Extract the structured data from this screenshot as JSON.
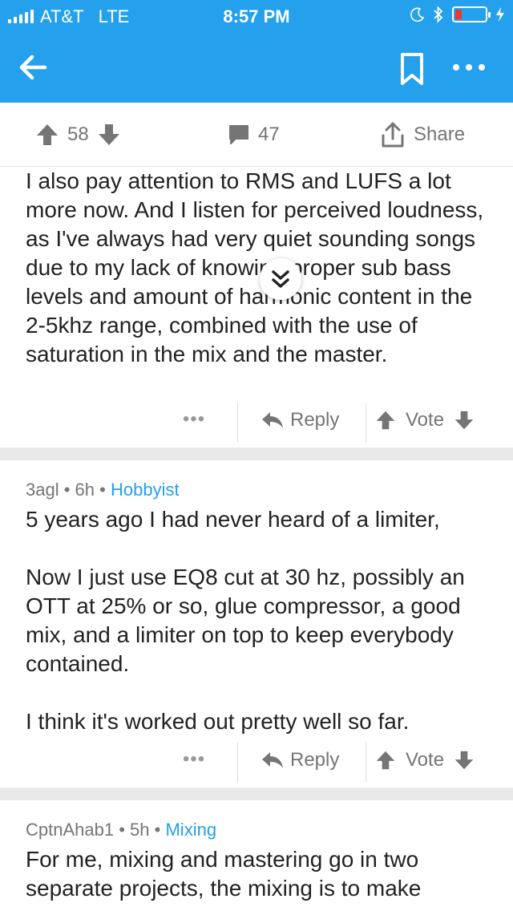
{
  "status_bar": {
    "carrier": "AT&T",
    "network": "LTE",
    "time": "8:57 PM",
    "battery_percent": 12
  },
  "post_actions": {
    "upvotes": "58",
    "comments": "47",
    "share_label": "Share"
  },
  "comments": [
    {
      "text": "I also pay attention to RMS and LUFS a lot more now.  And I listen for perceived loudness, as I've always had very quiet sounding songs due to my lack of knowing proper sub bass levels and amount of harmonic content in the 2-5khz range, combined with the use of saturation in the mix and the master.",
      "more": "•••",
      "reply_label": "Reply",
      "vote_label": "Vote"
    },
    {
      "author": "3agl",
      "age": "6h",
      "flair": "Hobbyist",
      "paragraphs": [
        "5 years ago I had never heard of a limiter,",
        "Now I just use EQ8 cut at 30 hz, possibly an OTT at 25% or so, glue compressor, a good mix, and a limiter on top to keep everybody contained.",
        "I think it's worked out pretty well so far."
      ],
      "more": "•••",
      "reply_label": "Reply",
      "vote_label": "Vote"
    },
    {
      "author": "CptnAhab1",
      "age": "5h",
      "flair": "Mixing",
      "text": "For me, mixing and mastering go in two separate projects, the mixing is to make"
    }
  ],
  "icons": {
    "back": "arrow-left-icon",
    "bookmark": "bookmark-icon",
    "more": "more-horizontal-icon",
    "upvote": "arrow-up-icon",
    "downvote": "arrow-down-icon",
    "comments": "comment-bubble-icon",
    "share": "share-icon",
    "reply": "reply-arrow-icon",
    "scroll_down": "double-chevron-down-icon"
  },
  "colors": {
    "brand": "#24a0ed",
    "text": "#222222",
    "muted": "#757575",
    "separator": "#e9e9e9",
    "battery_low": "#e53935"
  }
}
